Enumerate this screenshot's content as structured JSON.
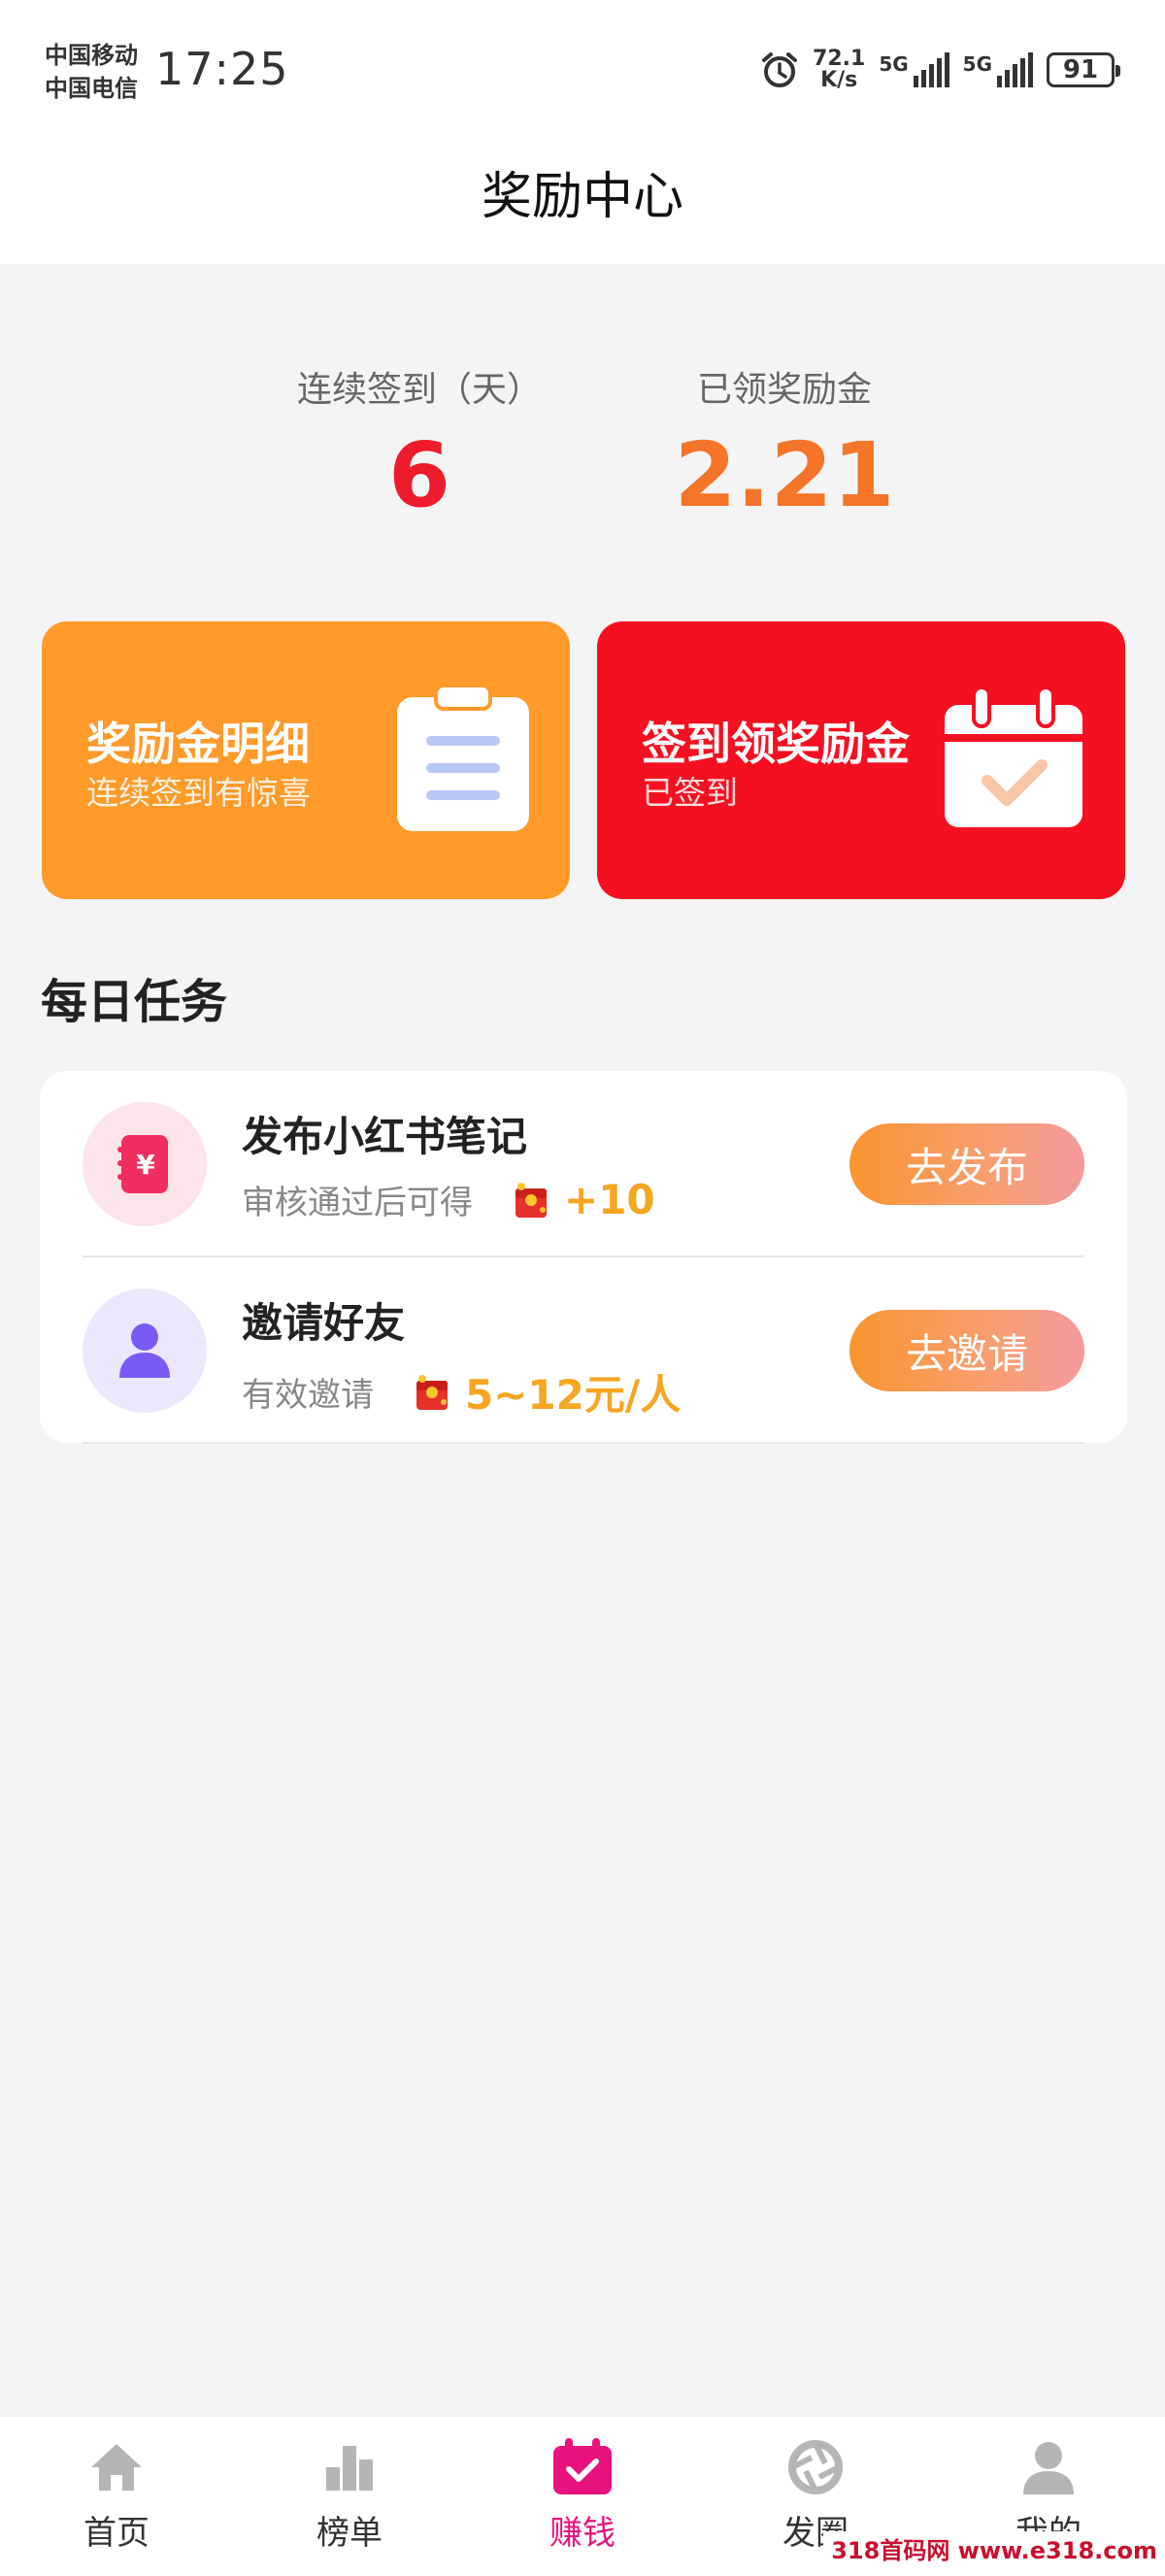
{
  "status_bar": {
    "carrier1": "中国移动",
    "carrier2": "中国电信",
    "time": "17:25",
    "speed_value": "72.1",
    "speed_unit": "K/s",
    "sig1_label": "5G",
    "sig2_label": "5G",
    "battery": "91"
  },
  "header": {
    "title": "奖励中心"
  },
  "stats": {
    "days_label": "连续签到（天）",
    "days_value": "6",
    "reward_label": "已领奖励金",
    "reward_value": "2.21"
  },
  "cards": {
    "details_title": "奖励金明细",
    "details_sub": "连续签到有惊喜",
    "checkin_title": "签到领奖励金",
    "checkin_sub": "已签到"
  },
  "daily": {
    "section_title": "每日任务",
    "tasks": [
      {
        "title": "发布小红书笔记",
        "desc": "审核通过后可得",
        "amount": "+10",
        "button": "去发布"
      },
      {
        "title": "邀请好友",
        "desc": "有效邀请",
        "amount": "5~12元/人",
        "button": "去邀请"
      }
    ]
  },
  "tabbar": {
    "items": [
      "首页",
      "榜单",
      "赚钱",
      "发圈",
      "我的"
    ],
    "active": "赚钱"
  },
  "watermark": "318首码网 www.e318.com",
  "colors": {
    "accent": "#e8127f",
    "orange": "#ff9a2b",
    "red": "#f51021",
    "gold": "#f5a623"
  }
}
